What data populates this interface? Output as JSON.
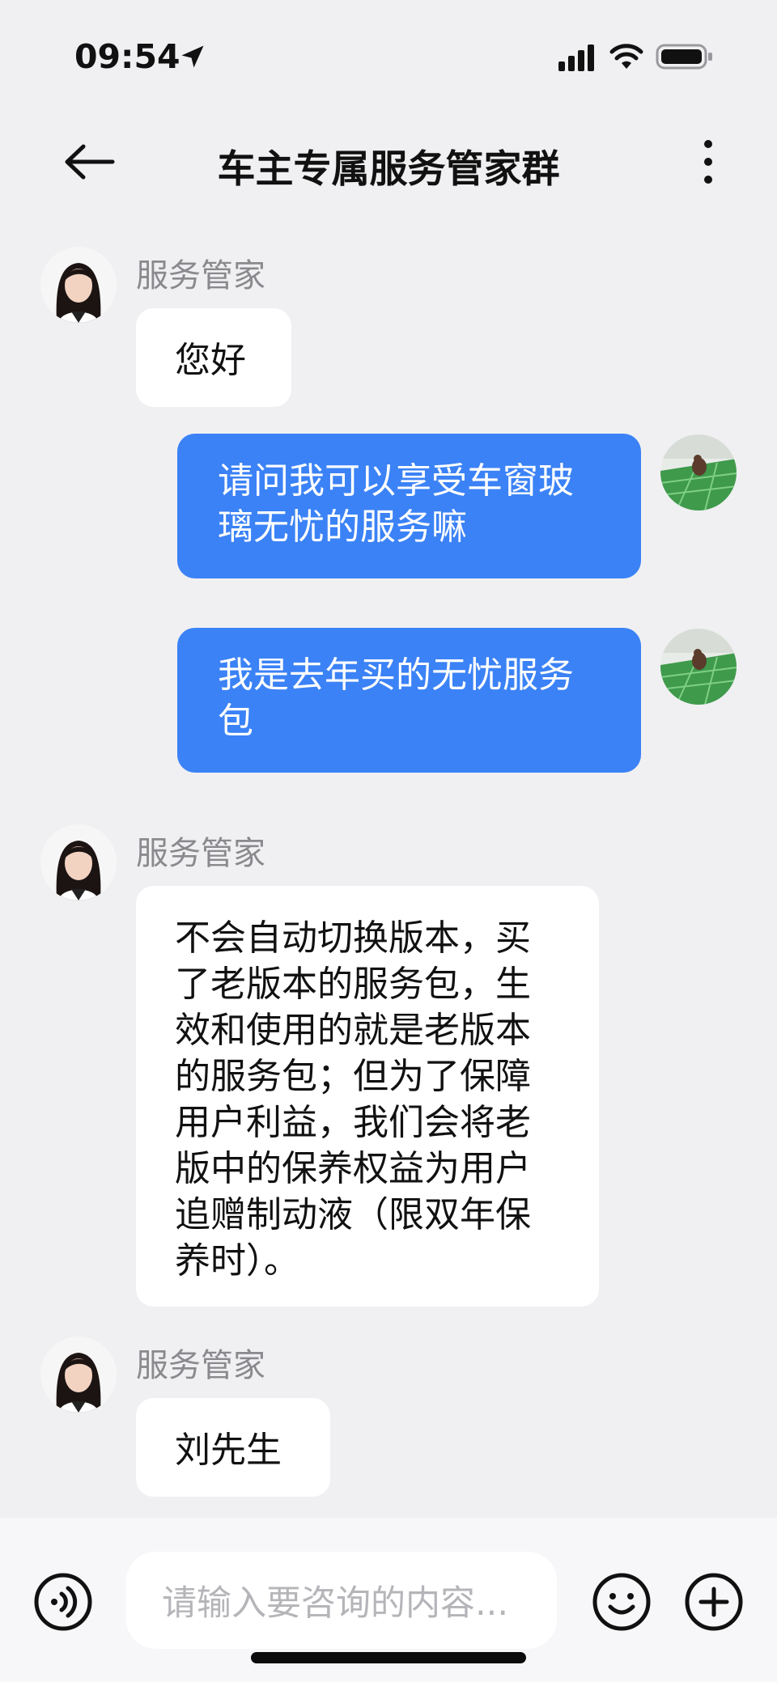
{
  "status_bar": {
    "time": "09:54",
    "icons": [
      "location-arrow-icon",
      "cellular-signal-icon",
      "wifi-icon",
      "battery-icon"
    ]
  },
  "nav": {
    "back_icon": "arrow-left-icon",
    "title": "车主专属服务管家群",
    "more_icon": "more-vertical-icon"
  },
  "messages": [
    {
      "direction": "in",
      "sender": "服务管家",
      "text": "您好"
    },
    {
      "direction": "out",
      "text": "请问我可以享受车窗玻璃无忧的服务嘛"
    },
    {
      "direction": "out",
      "text": "我是去年买的无忧服务包"
    },
    {
      "direction": "in",
      "sender": "服务管家",
      "text": "不会自动切换版本，买了老版本的服务包，生效和使用的就是老版本的服务包；但为了保障用户利益，我们会将老版中的保养权益为用户追赠制动液（限双年保养时）。"
    },
    {
      "direction": "in",
      "sender": "服务管家",
      "text": "刘先生"
    }
  ],
  "input_bar": {
    "voice_icon": "voice-input-icon",
    "placeholder": "请输入要咨询的内容...",
    "emoji_icon": "emoji-smile-icon",
    "plus_icon": "plus-circle-icon"
  },
  "colors": {
    "background": "#f0f0f2",
    "outgoing_bubble": "#3b82f6",
    "incoming_bubble": "#ffffff",
    "sender_name": "#8a8a8e"
  }
}
